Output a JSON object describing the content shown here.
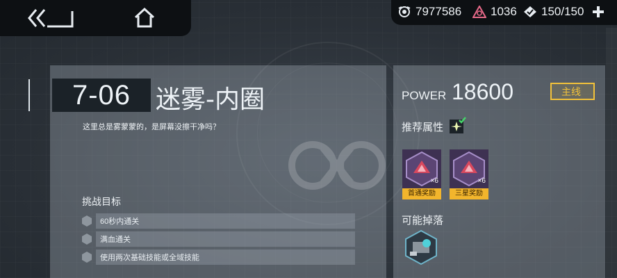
{
  "topbar": {
    "back_icon": "double-chevron-back-icon",
    "home_icon": "home-icon",
    "resources": [
      {
        "icon": "ink-icon",
        "value": "7977586"
      },
      {
        "icon": "crystal-icon",
        "value": "1036"
      },
      {
        "icon": "stamina-icon",
        "value": "150/150"
      }
    ],
    "plus_icon": "plus-icon"
  },
  "stage": {
    "number": "7-06",
    "name": "迷雾-内圈",
    "description": "这里总是雾蒙蒙的，是屏幕没擦干净吗？",
    "goals_title": "挑战目标",
    "goals": [
      "60秒内通关",
      "满血通关",
      "使用两次基础技能或全域技能"
    ]
  },
  "info": {
    "power_label": "POWER",
    "power_value": "18600",
    "tag": "主线",
    "recommended_label": "推荐属性",
    "rewards": [
      {
        "qty": "×6",
        "label": "首通奖励"
      },
      {
        "qty": "×6",
        "label": "三星奖励"
      }
    ],
    "drops_label": "可能掉落"
  },
  "colors": {
    "accent_gold": "#f2c23a",
    "reward_label_bg": "#f2b52c",
    "topbar_bg": "#0d1013"
  }
}
